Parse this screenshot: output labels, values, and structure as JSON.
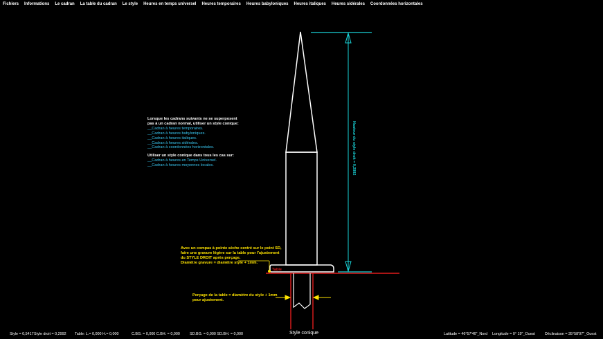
{
  "menu": [
    "Fichiers",
    "Informations",
    "Le cadran",
    "La table du cadran",
    "Le style",
    "Heures en temps universel",
    "Heures temporaires",
    "Heures babyloniques",
    "Heures italiques",
    "Heures sidérales",
    "Coordonnées horizontales"
  ],
  "notes": {
    "block1_title": [
      "Lorsque les cadrans suivants ne se superposent",
      "pas à un cadran normal, utiliser un style conique:"
    ],
    "block1_items": [
      "__Cadran à heures temporaires.",
      "__Cadran à heures babyloniques.",
      "__Cadran à heures italiques.",
      "__Cadran à heures sidérales.",
      "__Cadran à coordonnées horizontales."
    ],
    "block2_title": "Utiliser un style conique dans tous les cas sur:",
    "block2_items": [
      "__Cadran à heures en Temps Universel.",
      "__Cadran à heures moyennes locales."
    ]
  },
  "dimension_label": "Hauteur du style droit = 0,2992",
  "compass_note": [
    "Avec un compas à pointe sèche centré sur le point SD,",
    "faire une gravure légère sur la table pour l'ajustement",
    "du STYLE DROIT après perçage.",
    "Diamètre gravure = diamètre style + 1mm."
  ],
  "table_label": "Table",
  "drill_note": [
    "Perçage de la table = diamètre du style + 1mm",
    "pour ajustement."
  ],
  "status": {
    "style": "Style = 0,5417",
    "style_droit": "Style droit = 0,2992",
    "table": "Table:  L.= 0,000   H.= 0,000",
    "cbg": "C.BG. = 0,000   C.BH. = 0,000",
    "sdbg": "SD.BG. = 0,000   SD.BH. = 0,000",
    "title": "Style conique",
    "latitude": "Latitude = 46°57'46\"_Nord",
    "longitude": "Longitude = 0°     19\"_Ouest",
    "declinaison": "Déclinaison = 35°58'07\"_Ouest"
  },
  "colors": {
    "drawing": "#ffffff",
    "dimension": "#19d3d8",
    "note_text": "#ffe400",
    "table": "#e21c1c",
    "list_items": "#39c6f0"
  }
}
